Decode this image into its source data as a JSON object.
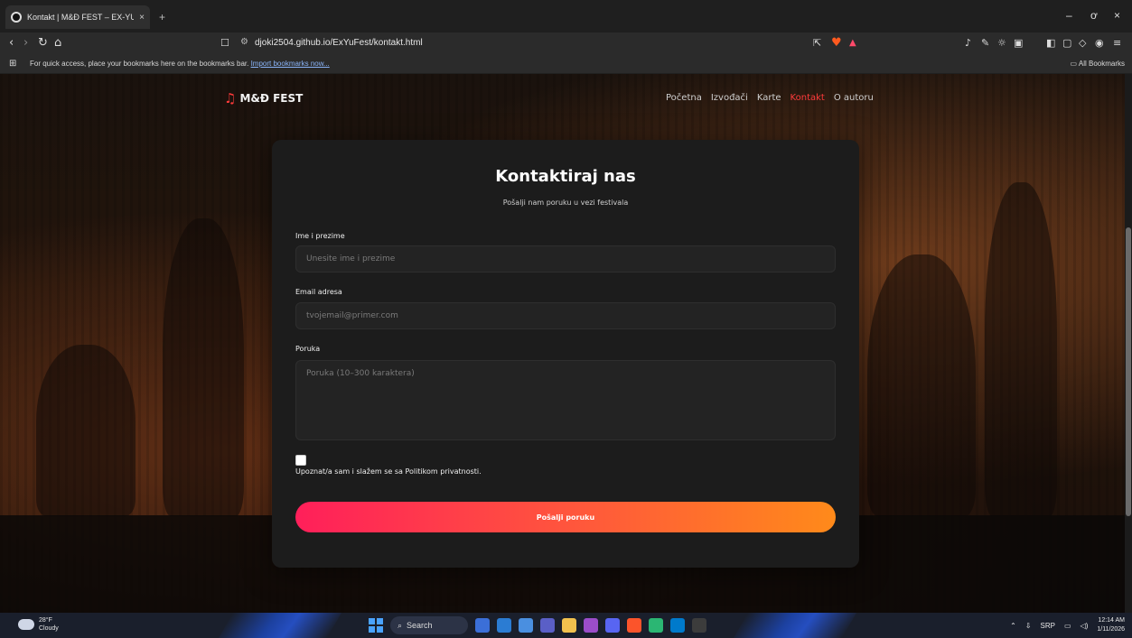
{
  "browser": {
    "tab_title": "Kontakt | M&Đ FEST – EX-YU M...",
    "tab_close": "×",
    "new_tab": "+",
    "url": "djoki2504.github.io/ExYuFest/kontakt.html",
    "bookmarks_text": "For quick access, place your bookmarks here on the bookmarks bar.",
    "bookmarks_link": "Import bookmarks now...",
    "all_bookmarks": "All Bookmarks",
    "window_min": "–",
    "window_restore": "ơ",
    "window_close": "×"
  },
  "site": {
    "logo_text": "M&Đ FEST",
    "nav": [
      "Početna",
      "Izvođači",
      "Karte",
      "Kontakt",
      "O autoru"
    ],
    "active_nav": "Kontakt"
  },
  "form": {
    "title": "Kontaktiraj nas",
    "subtitle": "Pošalji nam poruku u vezi festivala",
    "name_label": "Ime i prezime",
    "name_placeholder": "Unesite ime i prezime",
    "email_label": "Email adresa",
    "email_placeholder": "tvojemail@primer.com",
    "message_label": "Poruka",
    "message_placeholder": "Poruka (10–300 karaktera)",
    "privacy_label": "Upoznat/a sam i slažem se sa Politikom privatnosti.",
    "submit_label": "Pošalji poruku"
  },
  "taskbar": {
    "temperature": "28°F",
    "weather": "Cloudy",
    "search": "Search",
    "language": "SRP",
    "time": "12:14 AM",
    "date": "1/11/2026"
  },
  "colors": {
    "accent": "#ff3b3b",
    "button_start": "#ff1f5a",
    "button_end": "#ff8a1a",
    "card_bg": "#1c1c1c"
  }
}
